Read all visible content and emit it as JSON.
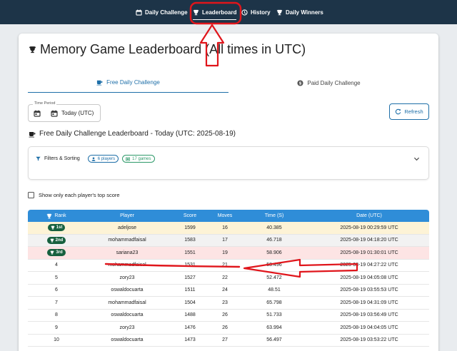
{
  "nav": {
    "items": [
      {
        "label": "Daily Challenge",
        "icon": "calendar-icon"
      },
      {
        "label": "Leaderboard",
        "icon": "trophy-icon",
        "active": true
      },
      {
        "label": "History",
        "icon": "history-icon"
      },
      {
        "label": "Daily Winners",
        "icon": "trophy-icon"
      }
    ]
  },
  "page": {
    "title": "Memory Game Leaderboard (All times in UTC)"
  },
  "tabs": {
    "free": "Free Daily Challenge",
    "paid": "Paid Daily Challenge"
  },
  "time_period": {
    "label": "Time Period",
    "value": "Today (UTC)"
  },
  "refresh_label": "Refresh",
  "leaderboard_title": "Free Daily Challenge Leaderboard - Today (UTC: 2025-08-19)",
  "filters": {
    "label": "Filters & Sorting",
    "players_chip": "6 players",
    "games_chip": "17 games"
  },
  "top_score_only_label": "Show only each player's top score",
  "table": {
    "headers": [
      "Rank",
      "Player",
      "Score",
      "Moves",
      "Time (S)",
      "Date (UTC)"
    ],
    "rows": [
      {
        "rank": "1st",
        "player": "adeljose",
        "score": "1599",
        "moves": "16",
        "time": "40.385",
        "date": "2025-08-19 00:29:59 UTC"
      },
      {
        "rank": "2nd",
        "player": "mohammadfaisal",
        "score": "1583",
        "moves": "17",
        "time": "46.718",
        "date": "2025-08-19 04:18:20 UTC"
      },
      {
        "rank": "3rd",
        "player": "sariana23",
        "score": "1551",
        "moves": "19",
        "time": "58.906",
        "date": "2025-08-19 01:30:01 UTC"
      },
      {
        "rank": "4",
        "player": "mohammadfaisal",
        "score": "1531",
        "moves": "21",
        "time": "58.496",
        "date": "2025-08-19 04:27:22 UTC"
      },
      {
        "rank": "5",
        "player": "zory23",
        "score": "1527",
        "moves": "22",
        "time": "52.472",
        "date": "2025-08-19 04:05:08 UTC"
      },
      {
        "rank": "6",
        "player": "oswaldocuarta",
        "score": "1511",
        "moves": "24",
        "time": "48.51",
        "date": "2025-08-19 03:55:53 UTC"
      },
      {
        "rank": "7",
        "player": "mohammadfaisal",
        "score": "1504",
        "moves": "23",
        "time": "65.798",
        "date": "2025-08-19 04:31:09 UTC"
      },
      {
        "rank": "8",
        "player": "oswaldocuarta",
        "score": "1488",
        "moves": "26",
        "time": "51.733",
        "date": "2025-08-19 03:56:49 UTC"
      },
      {
        "rank": "9",
        "player": "zory23",
        "score": "1476",
        "moves": "26",
        "time": "63.994",
        "date": "2025-08-19 04:04:05 UTC"
      },
      {
        "rank": "10",
        "player": "oswaldocuarta",
        "score": "1473",
        "moves": "27",
        "time": "56.497",
        "date": "2025-08-19 03:53:22 UTC"
      }
    ]
  },
  "colors": {
    "nav_bg": "#1d3448",
    "accent": "#1e6fa8",
    "table_header": "#2f8dd8",
    "rank_badge": "#17613f",
    "annotation": "#e0151b"
  }
}
